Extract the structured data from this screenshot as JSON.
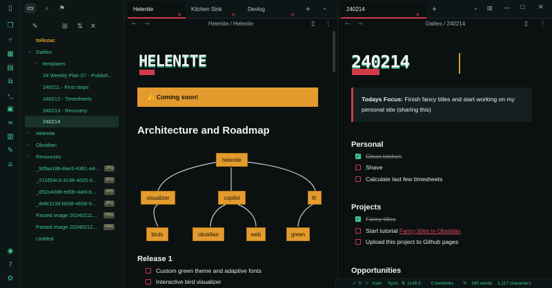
{
  "colors": {
    "accent": "#3ec98e",
    "red": "#d23a4a",
    "orange": "#e49b2e"
  },
  "ribbon": {
    "icons": [
      "sidebar-toggle-icon",
      "files-icon",
      "graph-icon",
      "grid-icon",
      "calendar-icon",
      "copy-icon",
      "terminal-icon",
      "folder-icon",
      "link-icon",
      "panel-icon",
      "wrench-icon",
      "bank-icon",
      "help-icon",
      "question-icon",
      "settings-icon"
    ]
  },
  "sidebar": {
    "vault_name": "tollezac",
    "items": [
      {
        "label": "Dailies"
      },
      {
        "label": "templates"
      },
      {
        "label": "24 Weekly Plan 07 - Publish..."
      },
      {
        "label": "240211 - First steps"
      },
      {
        "label": "240212 - Timesheets"
      },
      {
        "label": "240213 - Recovery"
      },
      {
        "label": "240214"
      },
      {
        "label": "Helenite"
      },
      {
        "label": "Obsidian"
      },
      {
        "label": "Resources"
      },
      {
        "label": "_92faa18b-8ae3-4361-a4...",
        "tag": "JPG"
      },
      {
        "label": "_211654c3-2c38-4d25-b...",
        "tag": "JPG"
      },
      {
        "label": "_d52c40d8-ed0b-4af4-b...",
        "tag": "JPG"
      },
      {
        "label": "_defe113d-b538-4608-9...",
        "tag": "JPG"
      },
      {
        "label": "Pasted image 20240211...",
        "tag": "PNG"
      },
      {
        "label": "Pasted image 20240212...",
        "tag": "PNG"
      },
      {
        "label": "Untitled"
      }
    ]
  },
  "left_pane": {
    "tabs": [
      {
        "label": "Helenite"
      },
      {
        "label": "Kitchen Sink"
      },
      {
        "label": "Devlog"
      }
    ],
    "breadcrumb": "Helenite / Helenite",
    "banner_text": "HELENITE",
    "callout": "👍 Coming soon!",
    "heading": "Architecture and Roadmap",
    "diagram": {
      "nodes": [
        "helenite",
        "visualizer",
        "copilot",
        "th",
        "birds",
        "obsidian",
        "web",
        "green"
      ]
    },
    "release_heading": "Release 1",
    "release_tasks": [
      "Custom green theme and adaptive fonts",
      "Interactive bird visualizer"
    ]
  },
  "right_pane": {
    "tab": "240214",
    "breadcrumb": "Dailies / 240214",
    "banner_text": "240214",
    "focus_label": "Todays Focus:",
    "focus_text": "Finish fancy titles and start working on my personal site (sharing this)",
    "personal_heading": "Personal",
    "personal_tasks": [
      {
        "text": "Clean kitchen",
        "done": true
      },
      {
        "text": "Shave",
        "done": false
      },
      {
        "text": "Calculate last few timesheets",
        "done": false
      }
    ],
    "projects_heading": "Projects",
    "project_tasks": [
      {
        "text": "Fancy titles",
        "done": true
      },
      {
        "text": "Start tutorial ",
        "link": "Fancy titles in Obsidian",
        "done": false
      },
      {
        "text": "Upload this project to Github pages",
        "done": false
      }
    ],
    "opportunities_heading": "Opportunities"
  },
  "status_bar": {
    "tasks": "5",
    "branch": "main",
    "sync": "Sync:",
    "sync_counts": "1148 0",
    "backlinks": "0 backlinks",
    "words": "185 words",
    "characters": "1,117 characters"
  }
}
